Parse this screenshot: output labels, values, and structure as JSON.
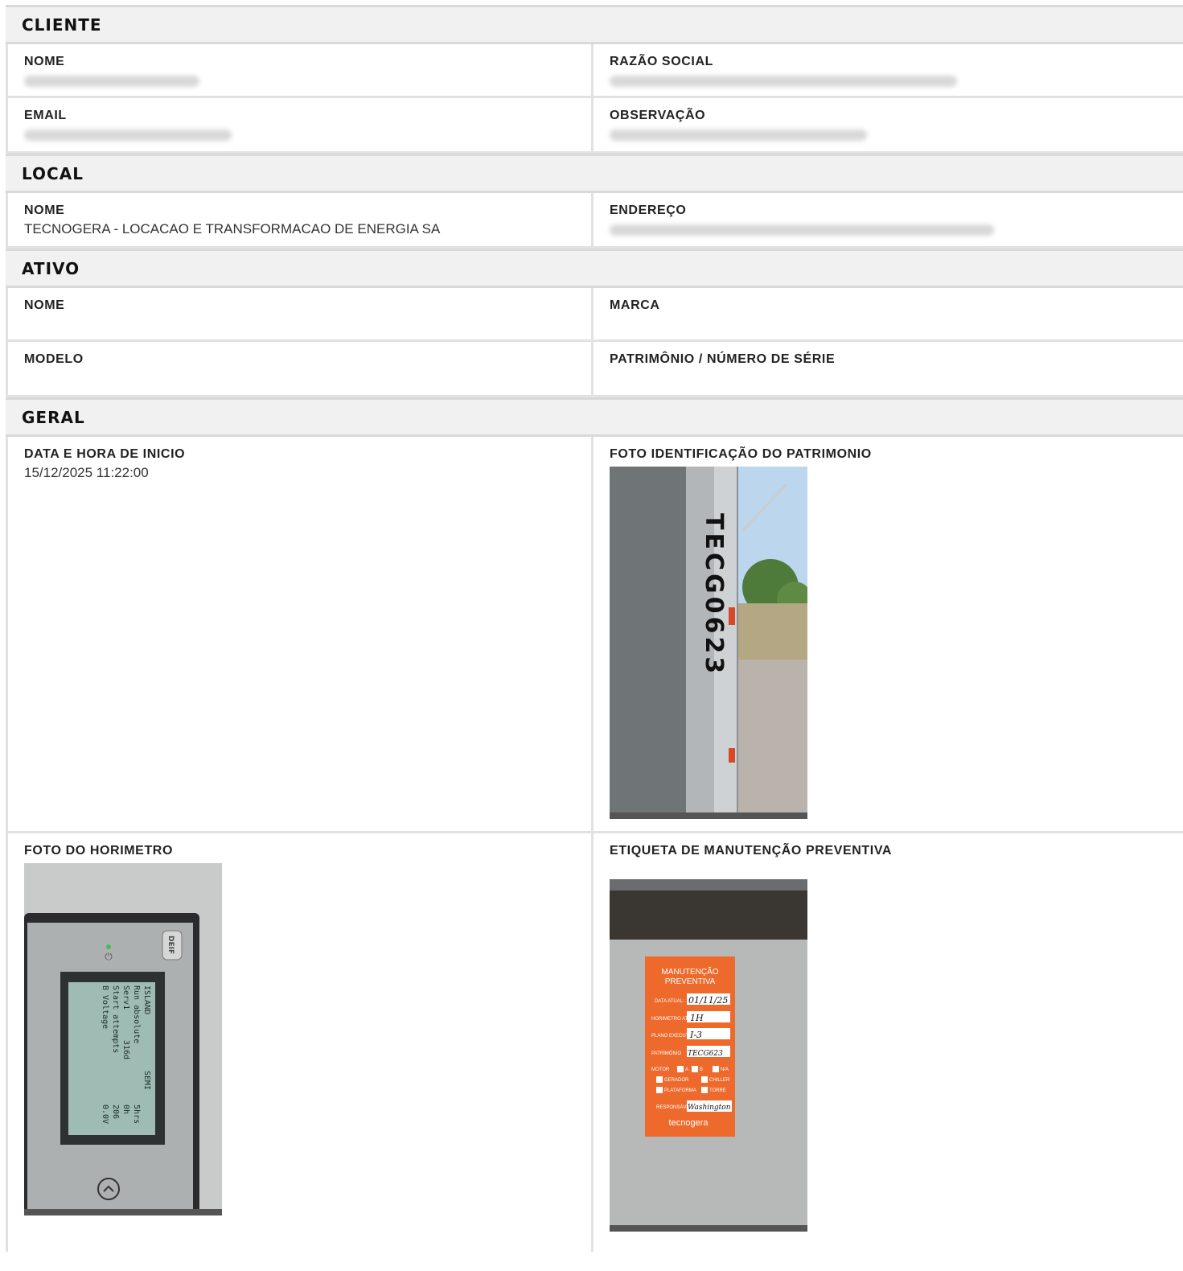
{
  "cliente": {
    "title": "CLIENTE",
    "nome_label": "NOME",
    "razao_label": "RAZÃO SOCIAL",
    "email_label": "EMAIL",
    "observacao_label": "OBSERVAÇÃO"
  },
  "local": {
    "title": "LOCAL",
    "nome_label": "NOME",
    "nome_value": "TECNOGERA - LOCACAO E TRANSFORMACAO DE ENERGIA SA",
    "endereco_label": "ENDEREÇO"
  },
  "ativo": {
    "title": "ATIVO",
    "nome_label": "NOME",
    "marca_label": "MARCA",
    "modelo_label": "MODELO",
    "patrimonio_label": "PATRIMÔNIO / NÚMERO DE SÉRIE"
  },
  "geral": {
    "title": "GERAL",
    "data_label": "DATA E HORA DE INICIO",
    "data_value": "15/12/2025 11:22:00",
    "foto_patrimonio_label": "FOTO IDENTIFICAÇÃO DO PATRIMONIO",
    "foto_horimetro_label": "FOTO DO HORIMETRO",
    "etiqueta_label": "ETIQUETA DE MANUTENÇÃO PREVENTIVA"
  },
  "photos": {
    "patrimonio_text": "TECG0623",
    "horimetro_screen": [
      "ISLAND",
      "Run absolute",
      "Serv1",
      "Start attempts",
      "B Voltage",
      "SEMI",
      "5hrs",
      "316d",
      "0h",
      "206",
      "0.0V"
    ],
    "horimetro_brand": "DEIF",
    "etiqueta": {
      "title_1": "MANUTENÇÃO",
      "title_2": "PREVENTIVA",
      "data_label": "DATA ATUAL:",
      "data_value": "01/11/25",
      "horimetro_label": "HORIMETRO ATUAL:",
      "horimetro_value": "1H",
      "plano_label": "PLANO EXECUTADO",
      "plano_value": "I-3",
      "patrimonio_label": "PATRIMÔNIO",
      "patrimonio_value": "TECG623",
      "motor": "MOTOR",
      "opt_a": "A",
      "opt_b": "B",
      "opt_na": "N/A",
      "gerador": "GERADOR",
      "chiller": "CHILLER",
      "plataforma": "PLATAFORMA",
      "torre": "TORRE",
      "responsavel_label": "RESPONSÁVEL:",
      "responsavel_value": "Washington",
      "brand": "tecnogera"
    }
  }
}
